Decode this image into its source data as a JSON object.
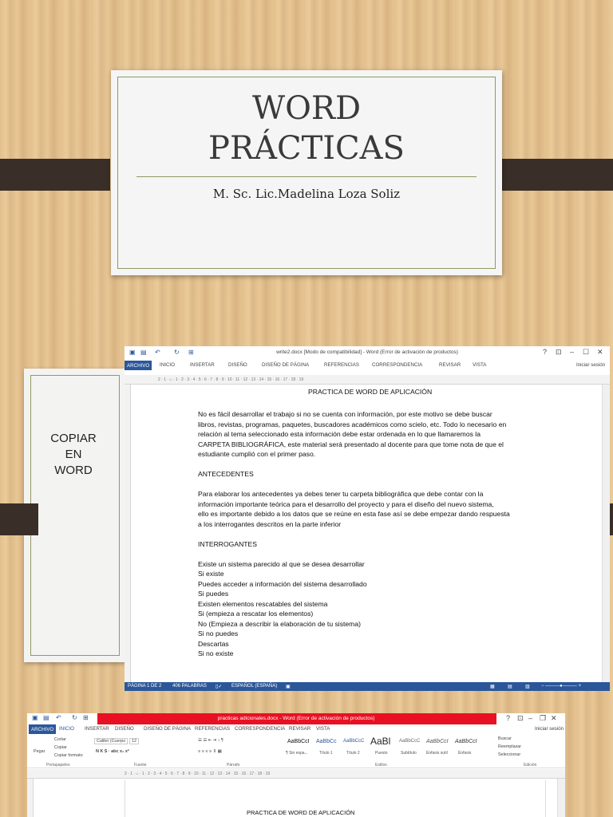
{
  "slide1": {
    "title_line1": "WORD",
    "title_line2": "PRÁCTICAS",
    "author": "M. Sc. Lic.Madelina Loza Soliz"
  },
  "slide2": {
    "label_line1": "COPIAR",
    "label_line2": "EN",
    "label_line3": "WORD"
  },
  "word1": {
    "title": "write2.docx [Modo de compatibilidad] - Word (Error de activación de productos)",
    "window_controls": [
      "?",
      "⊡",
      "–",
      "☐",
      "✕"
    ],
    "tabs": [
      "ARCHIVO",
      "INICIO",
      "INSERTAR",
      "DISEÑO",
      "DISEÑO DE PÁGINA",
      "REFERENCIAS",
      "CORRESPONDENCIA",
      "REVISAR",
      "VISTA"
    ],
    "signin": "Iniciar sesión",
    "ruler": "2 · 1 · ⌂ · 1 · 2 · 3 · 4 · 5 · 6 · 7 · 8 · 9 · 10 · 11 · 12 · 13 · 14 · 15 · 16 · 17 · 18 · 19",
    "doc_heading": "PRACTICA DE WORD DE APLICACIÓN",
    "lines": [
      "No es fácil desarrollar el trabajo si no se cuenta con información, por este motivo se debe buscar",
      "libros, revistas, programas, paquetes, buscadores académicos como scielo, etc. Todo lo necesario en",
      "relación al tema seleccionado esta información debe estar ordenada en lo que llamaremos la",
      "CARPETA BIBLIOGRÁFICA, este material será presentado al docente para que tome nota de que el",
      "estudiante cumplió con el primer paso.",
      "",
      "ANTECEDENTES",
      "",
      "Para elaborar los antecedentes ya debes tener tu carpeta bibliográfica que debe contar con la",
      "información importante teórica para el desarrollo del proyecto y para el diseño del nuevo sistema,",
      "ello es importante debido a los datos que se reúne en esta fase así se debe empezar dando respuesta",
      "a los interrogantes descritos en la parte inferior",
      "",
      "INTERROGANTES",
      "",
      "Existe un sistema parecido al que se desea desarrollar",
      "Si existe",
      "Puedes acceder a información del sistema desarrollado",
      "Si puedes",
      "Existen elementos rescatables del sistema",
      "Si (empieza a rescatar los elementos)",
      "No (Empieza a describir la elaboración de tu sistema)",
      "Si no puedes",
      "Descartas",
      "Si no existe"
    ],
    "status_page": "PÁGINA 1 DE 2",
    "status_words": "406 PALABRAS",
    "status_lang": "ESPAÑOL (ESPAÑA)"
  },
  "word2": {
    "title": "practicas adicionales.docx - Word (Error de activación de productos)",
    "window_controls": [
      "?",
      "⊡",
      "–",
      "❐",
      "✕"
    ],
    "tabs": [
      "ARCHIVO",
      "INICIO",
      "INSERTAR",
      "DISEÑO",
      "DISEÑO DE PÁGINA",
      "REFERENCIAS",
      "CORRESPONDENCIA",
      "REVISAR",
      "VISTA"
    ],
    "signin": "Iniciar sesión",
    "clipboard": {
      "paste": "Pegar",
      "cut": "Cortar",
      "copy": "Copiar",
      "format": "Copiar formato",
      "group": "Portapapeles"
    },
    "font": {
      "name": "Calibri (Cuerpo",
      "size": "12",
      "group": "Fuente",
      "format_buttons": "N  K  S  ·  abc  x₂  x²"
    },
    "paragraph_group": "Párrafo",
    "styles": [
      {
        "sample": "AaBbCcI",
        "name": "¶ Sin espa..."
      },
      {
        "sample": "AaBbCc",
        "name": "Título 1"
      },
      {
        "sample": "AaBbCcC",
        "name": "Título 2"
      },
      {
        "sample": "AaBl",
        "name": "Puesto"
      },
      {
        "sample": "AaBbCcC",
        "name": "Subtítulo"
      },
      {
        "sample": "AaBbCcI",
        "name": "Énfasis sutil"
      },
      {
        "sample": "AaBbCcI",
        "name": "Énfasis"
      }
    ],
    "styles_group": "Estilos",
    "editing": {
      "find": "Buscar",
      "replace": "Reemplazar",
      "select": "Seleccionar",
      "group": "Edición"
    },
    "ruler": "2 · 1 · ⌂ · 1 · 2 · 3 · 4 · 5 · 6 · 7 · 8 · 9 · 10 · 11 · 12 · 13 · 14 · 15 · 16 · 17 · 18 · 19",
    "doc_heading": "PRACTICA DE WORD DE APLICACIÓN"
  }
}
